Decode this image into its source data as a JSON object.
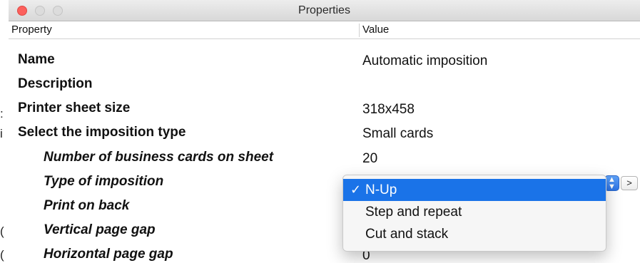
{
  "window": {
    "title": "Properties"
  },
  "table": {
    "header_property": "Property",
    "header_value": "Value",
    "rows": [
      {
        "name": "Name",
        "value": "Automatic imposition"
      },
      {
        "name": "Description",
        "value": ""
      },
      {
        "name": "Printer sheet size",
        "value": "318x458"
      },
      {
        "name": "Select the imposition type",
        "value": "Small cards"
      },
      {
        "name": "Number of business cards on sheet",
        "value": "20"
      },
      {
        "name": "Type of imposition",
        "value": ""
      },
      {
        "name": "Print on back",
        "value": ""
      },
      {
        "name": "Vertical page gap",
        "value": ""
      },
      {
        "name": "Horizontal page gap",
        "value": "0"
      }
    ]
  },
  "imposition_menu": {
    "selected": "N-Up",
    "options": [
      "N-Up",
      "Step and repeat",
      "Cut and stack"
    ],
    "check_glyph": "✓",
    "more_button_label": ">"
  },
  "background_window": {
    "glyphs": [
      ":",
      "i",
      "(",
      "("
    ]
  },
  "colors": {
    "selection": "#1a73e8",
    "close_button": "#fc605c"
  }
}
